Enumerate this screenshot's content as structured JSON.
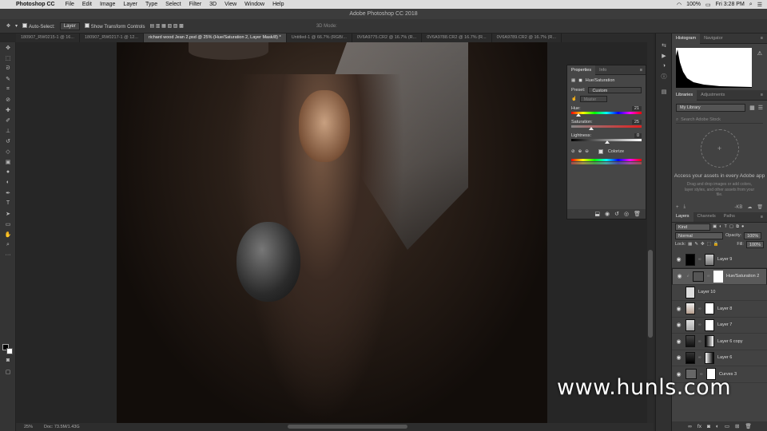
{
  "menubar": {
    "app": "Photoshop CC",
    "items": [
      "File",
      "Edit",
      "Image",
      "Layer",
      "Type",
      "Select",
      "Filter",
      "3D",
      "View",
      "Window",
      "Help"
    ],
    "battery": "100%",
    "clock": "Fri 3:28 PM"
  },
  "window_title": "Adobe Photoshop CC 2018",
  "options": {
    "auto_select": "Auto-Select:",
    "auto_select_value": "Layer",
    "transform": "Show Transform Controls",
    "mode_3d": "3D Mode:"
  },
  "tabs": [
    "180907_RW0215-1 @ 16...",
    "180907_RW0217-1 @ 12...",
    "richard wood Jean 2.psd @ 25% (Hue/Saturation 2, Layer Mask/8) *",
    "Untitled-1 @ 66.7% (RGB/...",
    "0V6A9775.CR2 @ 16.7% (R...",
    "0V6A9788.CR2 @ 16.7% (R...",
    "0V6A9789.CR2 @ 16.7% (R..."
  ],
  "properties": {
    "tabs": [
      "Properties",
      "Info"
    ],
    "adjustment": "Hue/Saturation",
    "preset_label": "Preset:",
    "preset_value": "Custom",
    "channel_value": "Master",
    "hue_label": "Hue:",
    "hue_value": "21",
    "saturation_label": "Saturation:",
    "saturation_value": "25",
    "lightness_label": "Lightness:",
    "lightness_value": "0",
    "colorize_label": "Colorize"
  },
  "histogram_panel": {
    "tabs": [
      "Histogram",
      "Navigator"
    ]
  },
  "libraries_panel": {
    "tabs": [
      "Libraries",
      "Adjustments"
    ],
    "library": "My Library",
    "search_placeholder": "Search Adobe Stock",
    "title": "Access your assets in every Adobe app",
    "text": "Drag and drop images or add colors, layer styles, and other assets from your file.",
    "size": "-KB"
  },
  "layers_panel": {
    "tabs": [
      "Layers",
      "Channels",
      "Paths"
    ],
    "kind": "Kind",
    "blend_mode": "Normal",
    "opacity_label": "Opacity:",
    "opacity_value": "100%",
    "lock_label": "Lock:",
    "fill_label": "Fill:",
    "fill_value": "100%",
    "layers": [
      {
        "name": "Layer 9"
      },
      {
        "name": "Hue/Saturation 2"
      },
      {
        "name": "Layer 10"
      },
      {
        "name": "Layer 8"
      },
      {
        "name": "Layer 7"
      },
      {
        "name": "Layer 6 copy"
      },
      {
        "name": "Layer 6"
      },
      {
        "name": "Curves 3"
      }
    ]
  },
  "status": {
    "zoom": "25%",
    "doc": "Doc: 73.5M/1.43G"
  },
  "watermark": "www.hunls.com"
}
